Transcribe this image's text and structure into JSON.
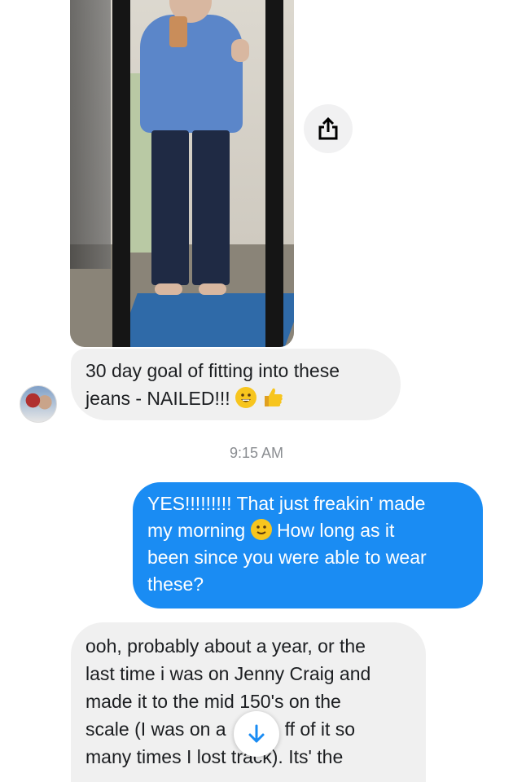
{
  "messages": [
    {
      "sender": "them",
      "text_line1": "30 day goal of fitting into these",
      "text_line2": "jeans - NAILED!!!",
      "emoji1": "grinning-face",
      "emoji2": "thumbs-up"
    },
    {
      "sender": "me",
      "part1": "YES!!!!!!!!! That just freakin' made",
      "part2": "my morning",
      "emoji": "slightly-smiling-face",
      "part3": "How long as it",
      "part4": "been since you were able to wear",
      "part5": "these?"
    },
    {
      "sender": "them",
      "lines": [
        "ooh, probably about a year, or the",
        "last time i was on Jenny Craig and",
        "made it to the mid 150's on the",
        "scale (I was on a",
        "ff of it so",
        "many times I lost track). Its' the"
      ]
    }
  ],
  "timestamp": "9:15 AM",
  "colors": {
    "outgoing_bubble": "#1a8cf3",
    "incoming_bubble": "#f0f0f0",
    "timestamp": "#8a8d91"
  },
  "icons": {
    "share": "share-icon",
    "scroll": "arrow-down-icon"
  }
}
